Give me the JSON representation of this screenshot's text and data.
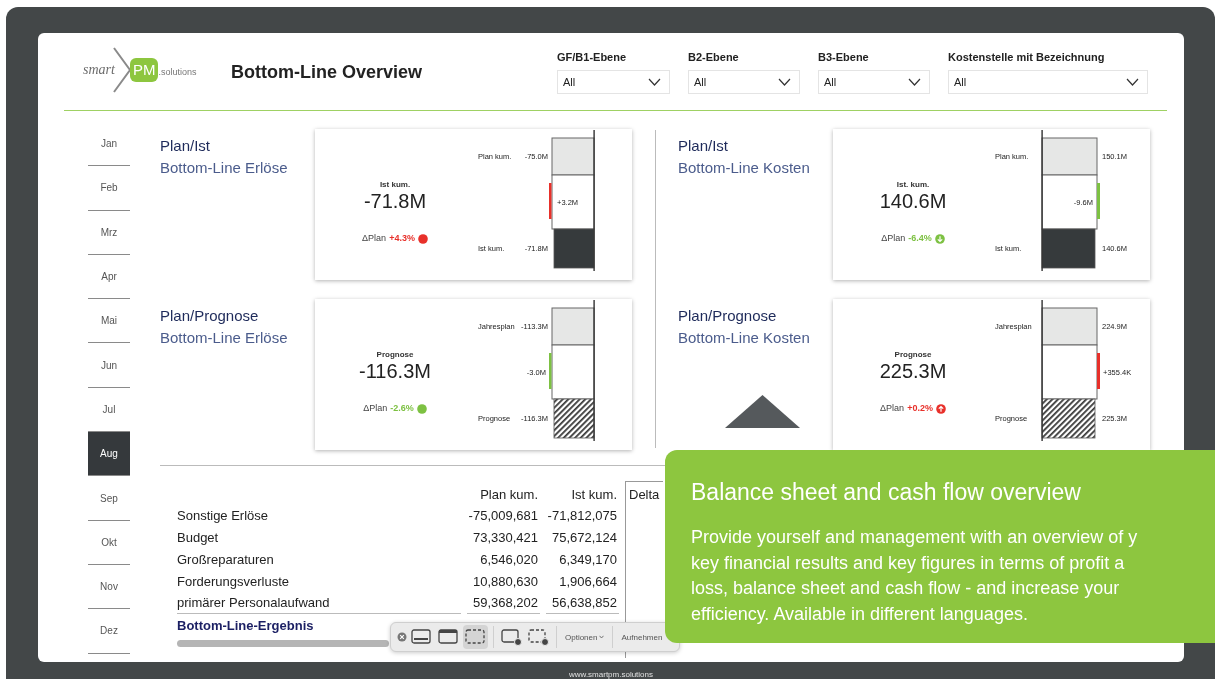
{
  "logo": {
    "word": "smart",
    "badge": "PM",
    "suffix": ".solutions"
  },
  "title": "Bottom-Line Overview",
  "filters": [
    {
      "label": "GF/B1-Ebene",
      "value": "All"
    },
    {
      "label": "B2-Ebene",
      "value": "All"
    },
    {
      "label": "B3-Ebene",
      "value": "All"
    },
    {
      "label": "Kostenstelle mit Bezeichnung",
      "value": "All"
    }
  ],
  "months": [
    {
      "label": "Jan",
      "selected": false
    },
    {
      "label": "Feb",
      "selected": false
    },
    {
      "label": "Mrz",
      "selected": false
    },
    {
      "label": "Apr",
      "selected": false
    },
    {
      "label": "Mai",
      "selected": false
    },
    {
      "label": "Jun",
      "selected": false
    },
    {
      "label": "Jul",
      "selected": false
    },
    {
      "label": "Aug",
      "selected": true
    },
    {
      "label": "Sep",
      "selected": false
    },
    {
      "label": "Okt",
      "selected": false
    },
    {
      "label": "Nov",
      "selected": false
    },
    {
      "label": "Dez",
      "selected": false
    }
  ],
  "panels": [
    {
      "heading": "Plan/Ist",
      "subheading": "Bottom-Line Erlöse",
      "kpi": {
        "label": "Ist kum.",
        "value": "-71.8M",
        "delta_label": "ΔPlan",
        "delta": "+4.3%",
        "color": "#e8302a",
        "indicator": {
          "kind": "dot"
        }
      },
      "waterfall": {
        "kind": "reversed",
        "rows": [
          {
            "kind": "plan",
            "label": "Plan kum.",
            "value": "-75.0M"
          },
          {
            "kind": "delta",
            "value": "+3.2M",
            "inside": true
          },
          {
            "kind": "actual",
            "label": "Ist kum.",
            "value": "-71.8M"
          }
        ]
      }
    },
    {
      "heading": "Plan/Ist",
      "subheading": "Bottom-Line Kosten",
      "kpi": {
        "label": "Ist. kum.",
        "value": "140.6M",
        "delta_label": "ΔPlan",
        "delta": "-6.4%",
        "color": "#7dc142",
        "indicator": {
          "kind": "down"
        }
      },
      "waterfall": {
        "kind": "standard",
        "rows": [
          {
            "kind": "plan",
            "label": "Plan kum.",
            "value": "150.1M"
          },
          {
            "kind": "delta",
            "value": "-9.6M",
            "inside": true
          },
          {
            "kind": "actual",
            "label": "Ist kum.",
            "value": "140.6M"
          }
        ]
      }
    },
    {
      "heading": "Plan/Prognose",
      "subheading": "Bottom-Line Erlöse",
      "kpi": {
        "label": "Prognose",
        "value": "-116.3M",
        "delta_label": "ΔPlan",
        "delta": "-2.6%",
        "color": "#7dc142",
        "indicator": {
          "kind": "dot"
        }
      },
      "waterfall": {
        "kind": "reversed",
        "rows": [
          {
            "kind": "plan",
            "label": "Jahresplan",
            "value": "-113.3M"
          },
          {
            "kind": "delta",
            "value": "-3.0M",
            "inside": false
          },
          {
            "kind": "forecast",
            "label": "Prognose",
            "value": "-116.3M"
          }
        ]
      }
    },
    {
      "heading": "Plan/Prognose",
      "subheading": "Bottom-Line Kosten",
      "kpi": {
        "label": "Prognose",
        "value": "225.3M",
        "delta_label": "ΔPlan",
        "delta": "+0.2%",
        "color": "#e8302a",
        "indicator": {
          "kind": "up"
        }
      },
      "waterfall": {
        "kind": "standard",
        "rows": [
          {
            "kind": "plan",
            "label": "Jahresplan",
            "value": "224.9M"
          },
          {
            "kind": "delta",
            "value": "+355.4K",
            "inside": false
          },
          {
            "kind": "forecast",
            "label": "Prognose",
            "value": "225.3M"
          }
        ]
      }
    }
  ],
  "table": {
    "columns": [
      "Plan kum.",
      "Ist kum.",
      "Delta"
    ],
    "rows": [
      {
        "label": "Sonstige Erlöse",
        "values": [
          "-75,009,681",
          "-71,812,075"
        ]
      },
      {
        "label": "Budget",
        "values": [
          "73,330,421",
          "75,672,124"
        ]
      },
      {
        "label": "Großreparaturen",
        "values": [
          "6,546,020",
          "6,349,170"
        ]
      },
      {
        "label": "Forderungsverluste",
        "values": [
          "10,880,630",
          "1,906,664"
        ]
      },
      {
        "label": "primärer Personalaufwand",
        "values": [
          "59,368,202",
          "56,638,852"
        ]
      }
    ],
    "total": {
      "label": "Bottom-Line-Ergebnis"
    }
  },
  "capture_toolbar": {
    "buttons": [
      {
        "kind": "screen",
        "selected": false
      },
      {
        "kind": "window",
        "selected": false
      },
      {
        "kind": "selection",
        "selected": true
      },
      {
        "kind": "record-screen",
        "selected": false
      },
      {
        "kind": "record-selection",
        "selected": false
      }
    ],
    "options": "Optionen",
    "capture": "Aufnehmen"
  },
  "promo": {
    "title": "Balance sheet and cash flow overview",
    "lines": [
      "Provide yourself and management with an overview of y",
      "key financial results and key figures in terms of profit a",
      "loss, balance sheet and cash flow - and increase your",
      "efficiency. Available in different languages."
    ]
  },
  "footer": "www.smartpm.solutions"
}
